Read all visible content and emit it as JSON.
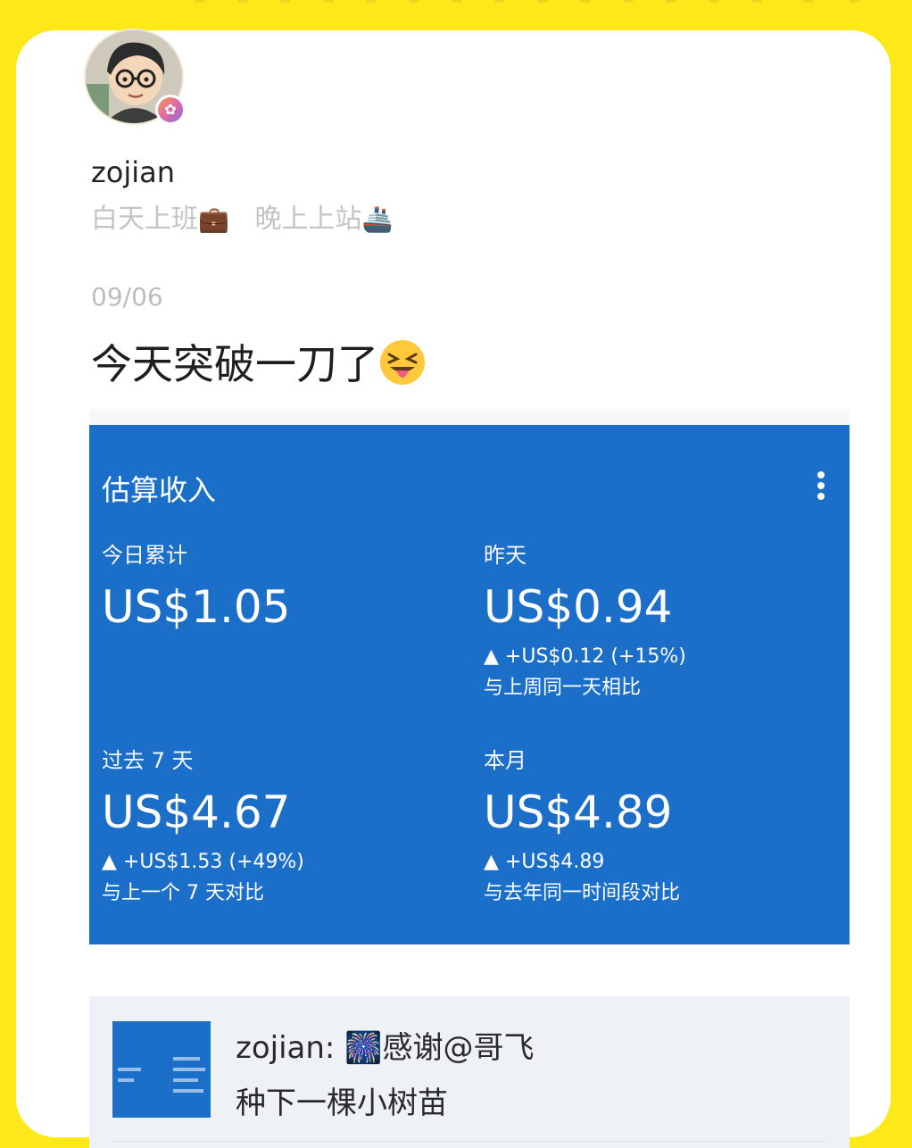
{
  "profile": {
    "username": "zojian",
    "bio_part1": "白天上班",
    "bio_emoji1": "💼",
    "bio_part2": "晚上上站",
    "bio_emoji2": "🚢"
  },
  "post": {
    "date": "09/06",
    "text": "今天突破一刀了"
  },
  "earnings_card": {
    "title": "估算收入",
    "today": {
      "label": "今日累计",
      "value": "US$1.05"
    },
    "yesterday": {
      "label": "昨天",
      "value": "US$0.94",
      "delta": "▲ +US$0.12 (+15%)",
      "compare": "与上周同一天相比"
    },
    "last7": {
      "label": "过去 7 天",
      "value": "US$4.67",
      "delta": "▲ +US$1.53 (+49%)",
      "compare": "与上一个 7 天对比"
    },
    "month": {
      "label": "本月",
      "value": "US$4.89",
      "delta": "▲ +US$4.89",
      "compare": "与去年同一时间段对比"
    }
  },
  "comment": {
    "line1_prefix": "zojian: ",
    "line1_emoji": "🎆",
    "line1_text": "感谢@哥飞",
    "line2": "种下一棵小树苗"
  },
  "colors": {
    "background": "#fde91a",
    "card_blue": "#1b6fc9"
  }
}
